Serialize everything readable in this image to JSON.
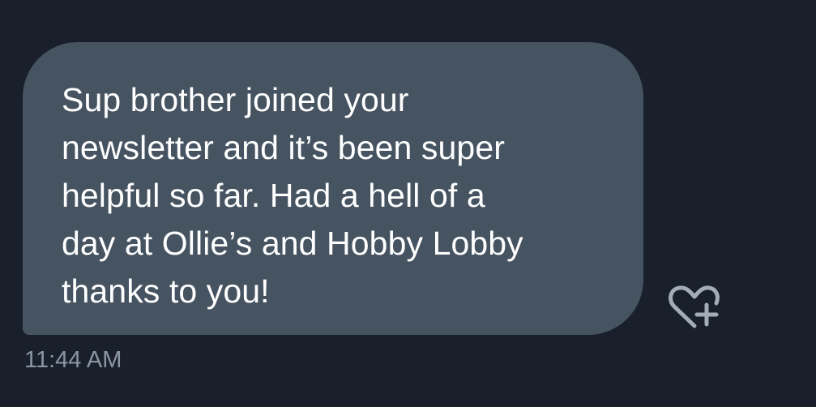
{
  "message": {
    "text": "Sup brother joined your\nnewsletter and it’s been super\nhelpful so far. Had a hell of a\nday at Ollie’s and Hobby Lobby\nthanks to you!",
    "timestamp": "11:44 AM"
  },
  "actions": {
    "react_icon": "heart-plus-icon"
  },
  "colors": {
    "background": "#19202b",
    "bubble": "#465462",
    "message_text": "#ffffff",
    "timestamp_text": "#8b96a3",
    "icon": "#a3acb7"
  }
}
